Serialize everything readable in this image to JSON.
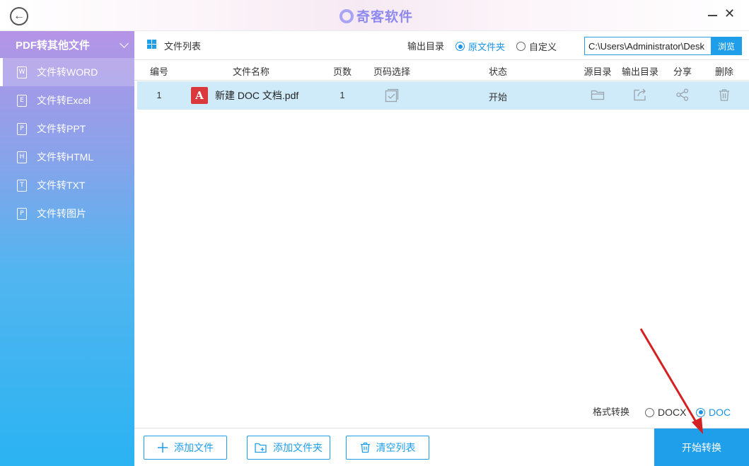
{
  "titlebar": {
    "logo_text": "奇客软件",
    "close_glyph": "✕",
    "back_glyph": "←"
  },
  "sidebar": {
    "header": "PDF转其他文件",
    "items": [
      {
        "label": "文件转WORD",
        "icon_letter": "W",
        "active": true
      },
      {
        "label": "文件转Excel",
        "icon_letter": "E",
        "active": false
      },
      {
        "label": "文件转PPT",
        "icon_letter": "P",
        "active": false
      },
      {
        "label": "文件转HTML",
        "icon_letter": "H",
        "active": false
      },
      {
        "label": "文件转TXT",
        "icon_letter": "T",
        "active": false
      },
      {
        "label": "文件转图片",
        "icon_letter": "P",
        "active": false
      }
    ]
  },
  "toolbar": {
    "list_title": "文件列表",
    "output_label": "输出目录",
    "option_original": "原文件夹",
    "option_custom": "自定义",
    "selected_option": "原文件夹",
    "path_value": "C:\\Users\\Administrator\\Desk",
    "browse_label": "浏览"
  },
  "table": {
    "headers": [
      "编号",
      "文件名称",
      "页数",
      "页码选择",
      "状态",
      "源目录",
      "输出目录",
      "分享",
      "删除"
    ],
    "rows": [
      {
        "index": "1",
        "name": "新建 DOC 文档.pdf",
        "pages": "1",
        "status": "开始",
        "file_icon": "pdf-icon"
      }
    ]
  },
  "format": {
    "label": "格式转换",
    "options": [
      "DOCX",
      "DOC"
    ],
    "selected": "DOC"
  },
  "footer": {
    "add_file": "添加文件",
    "add_folder": "添加文件夹",
    "clear_list": "清空列表",
    "start": "开始转换"
  },
  "colors": {
    "accent": "#1f9ee9",
    "row_highlight": "#cfeaf9",
    "sidebar_top": "#b594e6",
    "sidebar_bottom": "#2bb3f2",
    "annotation_arrow": "#d42020"
  },
  "icons": [
    "back-icon",
    "logo-icon",
    "minimize-icon",
    "close-icon",
    "chevron-down-icon",
    "grid-icon",
    "pdf-icon",
    "checkbox-icon",
    "folder-icon",
    "export-icon",
    "share-icon",
    "trash-icon",
    "plus-icon",
    "folder-add-icon"
  ]
}
